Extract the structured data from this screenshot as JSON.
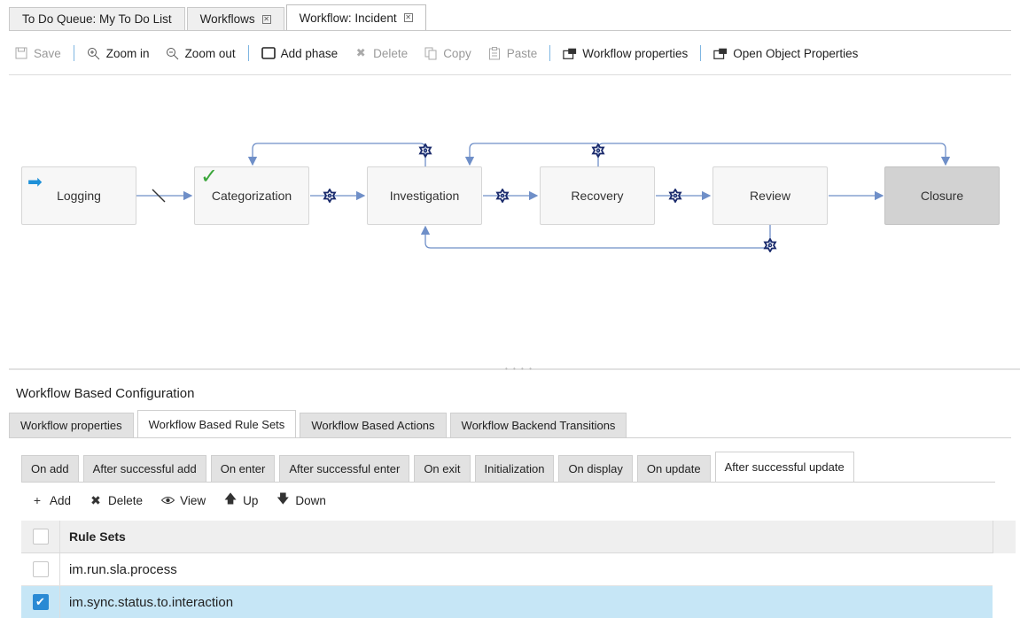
{
  "top_tabs": [
    {
      "label": "To Do Queue: My To Do List",
      "closable": false,
      "active": false
    },
    {
      "label": "Workflows",
      "closable": true,
      "active": false
    },
    {
      "label": "Workflow: Incident",
      "closable": true,
      "active": true
    }
  ],
  "toolbar": {
    "save": "Save",
    "zoom_in": "Zoom in",
    "zoom_out": "Zoom out",
    "add_phase": "Add phase",
    "delete": "Delete",
    "copy": "Copy",
    "paste": "Paste",
    "workflow_properties": "Workflow properties",
    "open_object_properties": "Open Object Properties"
  },
  "workflow": {
    "phases": [
      "Logging",
      "Categorization",
      "Investigation",
      "Recovery",
      "Review",
      "Closure"
    ],
    "start_phase": "Logging",
    "current_phase": "Categorization",
    "final_phase": "Closure"
  },
  "config": {
    "title": "Workflow Based Configuration",
    "main_tabs": [
      "Workflow properties",
      "Workflow Based Rule Sets",
      "Workflow Based Actions",
      "Workflow Backend Transitions"
    ],
    "main_active": "Workflow Based Rule Sets",
    "event_tabs": [
      "On add",
      "After successful add",
      "On enter",
      "After successful enter",
      "On exit",
      "Initialization",
      "On display",
      "On update",
      "After successful update"
    ],
    "event_active": "After successful update",
    "actions": {
      "add": "Add",
      "delete": "Delete",
      "view": "View",
      "up": "Up",
      "down": "Down"
    },
    "grid": {
      "header": "Rule Sets",
      "rows": [
        {
          "name": "im.run.sla.process",
          "checked": false
        },
        {
          "name": "im.sync.status.to.interaction",
          "checked": true
        }
      ]
    }
  },
  "colors": {
    "connector": "#6f8fc8",
    "gear": "#1a2a6b",
    "selected_row": "#c6e6f6",
    "checkbox_checked": "#2a8ad4"
  }
}
